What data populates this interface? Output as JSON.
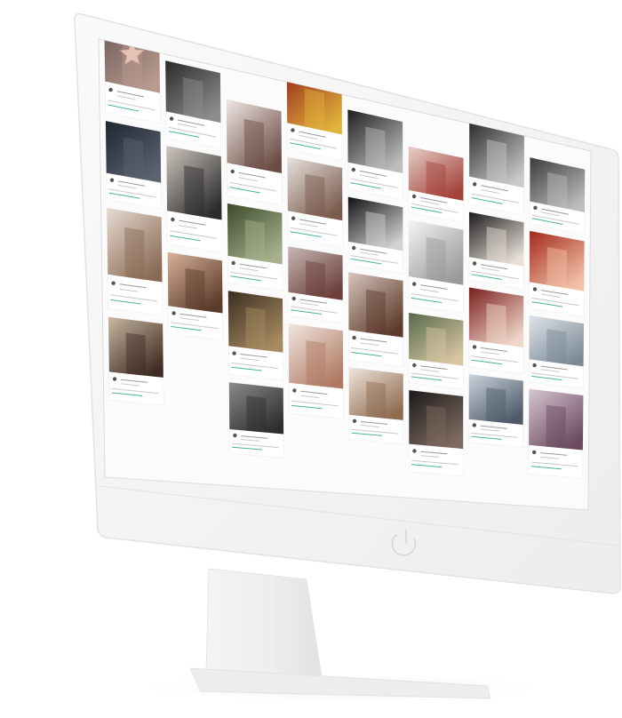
{
  "scene": {
    "subject": "imac-mockup",
    "screen_content": "social-photo-grid",
    "colors": {
      "bezel": "#f3f2f2",
      "bezel_edge": "#e4e2e2",
      "chin": "#efeeee",
      "stand": "#ecebeb",
      "screen_bg": "#fbfbfb",
      "caption_line": "#c9c9c9",
      "accent_line": "#4bb3a0"
    },
    "icons": [
      "power-icon"
    ]
  },
  "grid": {
    "columns": [
      {
        "tiles": [
          {
            "c1": "#6b5a56",
            "c2": "#b89a8e",
            "motif": "star"
          },
          {
            "c1": "#1f2530",
            "c2": "#5b6272"
          },
          {
            "c1": "#e7dcd2",
            "c2": "#8a6a55"
          },
          {
            "c1": "#c7b7a2",
            "c2": "#3f2d23"
          }
        ]
      },
      {
        "tiles": [
          {
            "c1": "#2a2a2a",
            "c2": "#8d8d8d"
          },
          {
            "c1": "#cfc8c0",
            "c2": "#2c2c2c"
          },
          {
            "c1": "#d9b39a",
            "c2": "#5a3a2a"
          }
        ]
      },
      {
        "tiles": [
          {
            "c1": "#f1e9e4",
            "c2": "#6b4b45"
          },
          {
            "c1": "#3b4a2b",
            "c2": "#a7b18d"
          },
          {
            "c1": "#3a2d1f",
            "c2": "#a88b62"
          },
          {
            "c1": "#8b8b8b",
            "c2": "#2e2e2e"
          }
        ]
      },
      {
        "tiles": [
          {
            "c1": "#9c2f1e",
            "c2": "#e1b33b"
          },
          {
            "c1": "#e8e2de",
            "c2": "#7a5b4d"
          },
          {
            "c1": "#c7b9b5",
            "c2": "#6b3e3a"
          },
          {
            "c1": "#f1e7e1",
            "c2": "#b07a62"
          }
        ]
      },
      {
        "tiles": [
          {
            "c1": "#1e1e1e",
            "c2": "#bdbdbd"
          },
          {
            "c1": "#111111",
            "c2": "#d2d2d2"
          },
          {
            "c1": "#d8c6bd",
            "c2": "#5d3a2c"
          },
          {
            "c1": "#efe6dd",
            "c2": "#8f6b50"
          }
        ]
      },
      {
        "tiles": [
          {
            "c1": "#e6d0c8",
            "c2": "#a3423a"
          },
          {
            "c1": "#f5f5f5",
            "c2": "#9a9a9a"
          },
          {
            "c1": "#556a4a",
            "c2": "#d8c5a2"
          },
          {
            "c1": "#1b1b1b",
            "c2": "#7e6a60"
          }
        ]
      },
      {
        "tiles": [
          {
            "c1": "#2a2a2a",
            "c2": "#c9c9c9"
          },
          {
            "c1": "#1b1b1b",
            "c2": "#e9e0d8"
          },
          {
            "c1": "#7a1d1d",
            "c2": "#f0d7c9"
          },
          {
            "c1": "#cbd3dc",
            "c2": "#4e5a68"
          }
        ]
      },
      {
        "tiles": [
          {
            "c1": "#3a3a3a",
            "c2": "#bdbdbd"
          },
          {
            "c1": "#a4281c",
            "c2": "#f2c1a6"
          },
          {
            "c1": "#dfe5ea",
            "c2": "#7d8a96"
          },
          {
            "c1": "#d7c6d2",
            "c2": "#6b4a5e"
          }
        ]
      }
    ]
  }
}
